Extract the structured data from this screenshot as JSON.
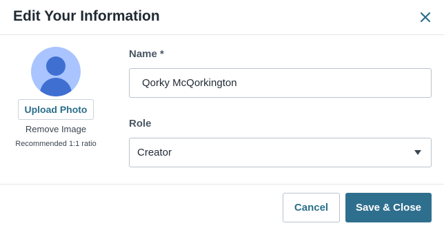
{
  "dialog": {
    "title": "Edit Your Information",
    "close_icon": "close-icon",
    "accent_color": "#2f6f8e"
  },
  "photo": {
    "avatar_icon": "user-avatar-icon",
    "upload_label": "Upload Photo",
    "remove_label": "Remove Image",
    "hint": "Recommended 1:1 ratio"
  },
  "form": {
    "name": {
      "label": "Name *",
      "value": "Qorky McQorkington"
    },
    "role": {
      "label": "Role",
      "selected": "Creator",
      "dropdown_icon": "caret-down-icon"
    }
  },
  "footer": {
    "cancel_label": "Cancel",
    "save_label": "Save & Close"
  }
}
